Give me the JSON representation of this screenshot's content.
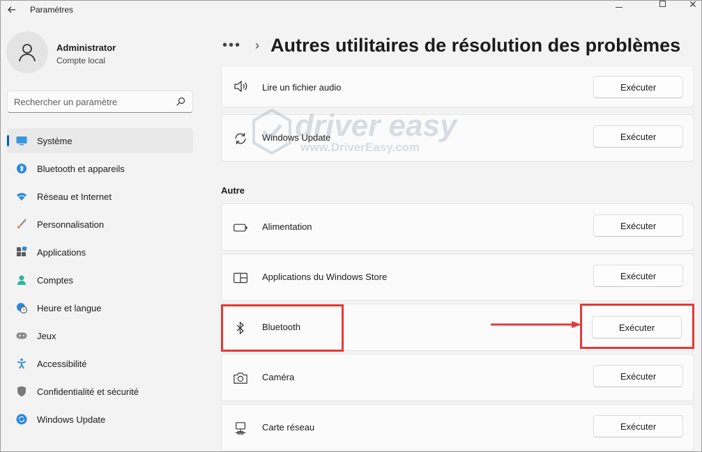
{
  "window": {
    "title": "Paramètres"
  },
  "user": {
    "name": "Administrator",
    "account_type": "Compte local"
  },
  "search": {
    "placeholder": "Rechercher un paramètre"
  },
  "sidebar": {
    "items": [
      {
        "label": "Système",
        "icon": "system-icon",
        "active": true
      },
      {
        "label": "Bluetooth et appareils",
        "icon": "bluetooth-icon"
      },
      {
        "label": "Réseau et Internet",
        "icon": "wifi-icon"
      },
      {
        "label": "Personnalisation",
        "icon": "brush-icon"
      },
      {
        "label": "Applications",
        "icon": "apps-icon"
      },
      {
        "label": "Comptes",
        "icon": "person-icon"
      },
      {
        "label": "Heure et langue",
        "icon": "clock-globe-icon"
      },
      {
        "label": "Jeux",
        "icon": "gamepad-icon"
      },
      {
        "label": "Accessibilité",
        "icon": "accessibility-icon"
      },
      {
        "label": "Confidentialité et sécurité",
        "icon": "shield-icon"
      },
      {
        "label": "Windows Update",
        "icon": "update-icon"
      }
    ]
  },
  "header": {
    "breadcrumb_more": "•••",
    "title": "Autres utilitaires de résolution des problèmes"
  },
  "troubleshooters_top": [
    {
      "label": "Lire un fichier audio",
      "icon": "speaker-icon",
      "button": "Exécuter"
    },
    {
      "label": "Windows Update",
      "icon": "refresh-icon",
      "button": "Exécuter"
    }
  ],
  "section": {
    "title": "Autre"
  },
  "troubleshooters_other": [
    {
      "label": "Alimentation",
      "icon": "battery-icon",
      "button": "Exécuter"
    },
    {
      "label": "Applications du Windows Store",
      "icon": "store-app-icon",
      "button": "Exécuter"
    },
    {
      "label": "Bluetooth",
      "icon": "bluetooth-icon",
      "button": "Exécuter",
      "highlighted": true
    },
    {
      "label": "Caméra",
      "icon": "camera-icon",
      "button": "Exécuter"
    },
    {
      "label": "Carte réseau",
      "icon": "network-adapter-icon",
      "button": "Exécuter"
    }
  ],
  "watermark": {
    "brand": "driver easy",
    "url": "www.DriverEasy.com"
  },
  "colors": {
    "accent": "#005fb8",
    "annotation": "#e53935"
  }
}
